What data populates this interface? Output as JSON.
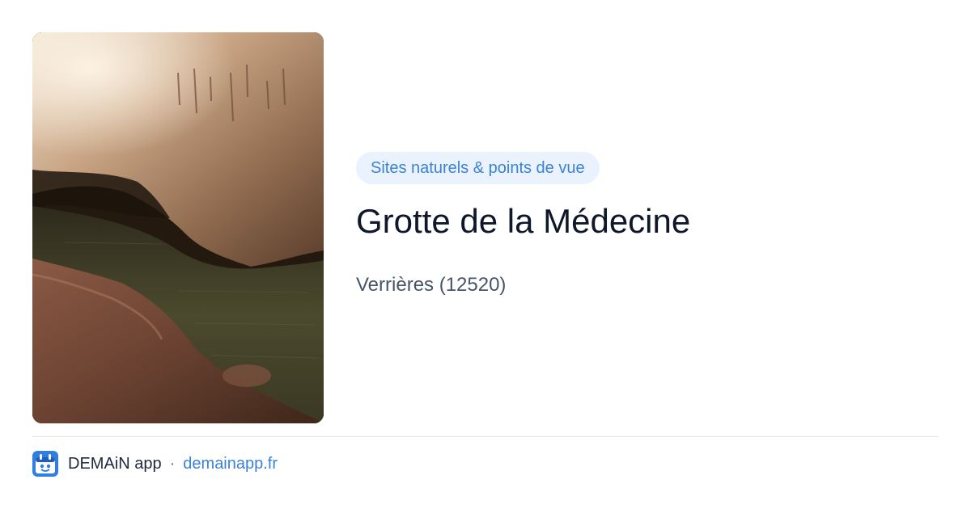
{
  "card": {
    "image_alt": "Grotte de la Médecine",
    "category": "Sites naturels & points de vue",
    "title": "Grotte de la Médecine",
    "location": "Verrières (12520)"
  },
  "footer": {
    "logo_icon": "demain-app-logo-icon",
    "app_name": "DEMAiN app",
    "separator": "·",
    "link_text": "demainapp.fr"
  },
  "colors": {
    "accent": "#3b82d6",
    "badge_bg": "#eaf3fd",
    "title": "#0f172a",
    "subtitle": "#475569",
    "divider": "#dde3ea"
  }
}
